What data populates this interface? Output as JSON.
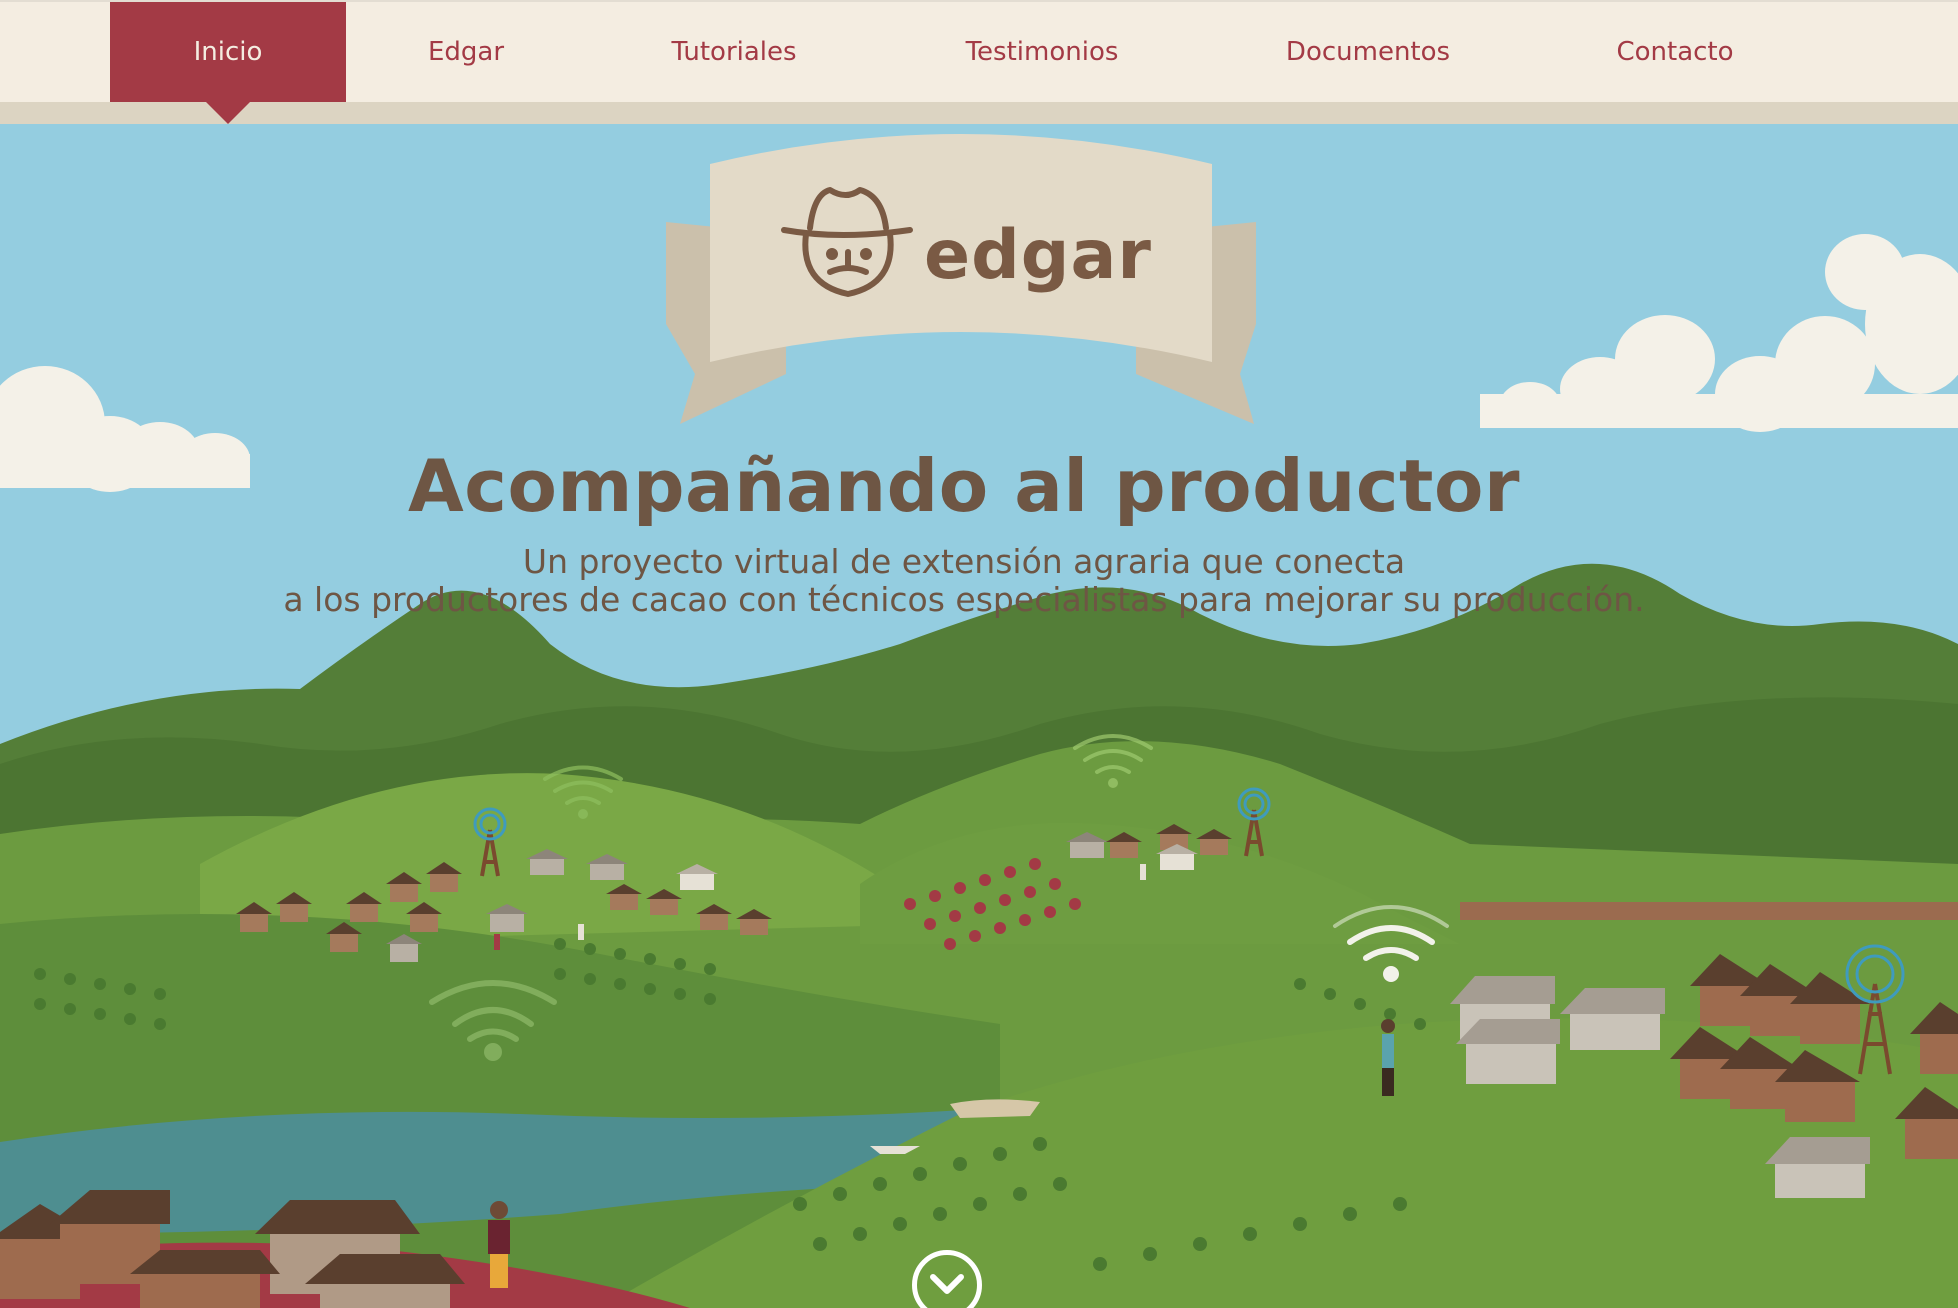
{
  "nav": {
    "items": [
      {
        "label": "Inicio",
        "active": true
      },
      {
        "label": "Edgar",
        "active": false
      },
      {
        "label": "Tutoriales",
        "active": false
      },
      {
        "label": "Testimonios",
        "active": false
      },
      {
        "label": "Documentos",
        "active": false
      },
      {
        "label": "Contacto",
        "active": false
      }
    ]
  },
  "hero": {
    "logo_text": "edgar",
    "headline": "Acompañando al productor",
    "subline_1": "Un proyecto virtual de extensión agraria que conecta",
    "subline_2": "a los productores de cacao con técnicos especialistas para mejorar su producción."
  },
  "icons": [
    "farmer-face-icon",
    "wifi-signal-icon",
    "radio-tower-icon",
    "chevron-down-icon"
  ],
  "colors": {
    "brand": "#a33a45",
    "nav_bg": "#f4ede1",
    "text_brown": "#6e5644",
    "sky": "#94cde0",
    "banner": "#e3dac8"
  }
}
